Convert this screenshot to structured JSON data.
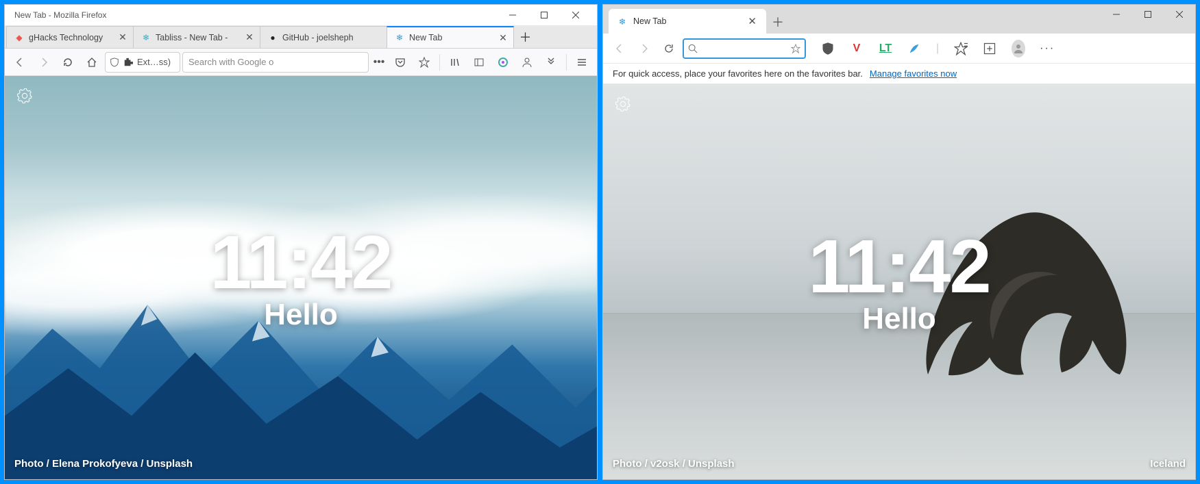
{
  "firefox": {
    "window_title": "New Tab - Mozilla Firefox",
    "tabs": [
      {
        "label": "gHacks Technology"
      },
      {
        "label": "Tabliss - New Tab -"
      },
      {
        "label": "GitHub - joelsheph"
      },
      {
        "label": "New Tab"
      }
    ],
    "urlbar_text": "Ext…ss)",
    "searchbar_placeholder": "Search with Google o",
    "content": {
      "time": "11:42",
      "greeting": "Hello",
      "credit": "Photo / Elena Prokofyeva / Unsplash"
    }
  },
  "edge": {
    "tab_label": "New Tab",
    "favbar_text": "For quick access, place your favorites here on the favorites bar.",
    "favbar_link": "Manage favorites now",
    "content": {
      "time": "11:42",
      "greeting": "Hello",
      "credit": "Photo / v2osk / Unsplash",
      "location": "Iceland"
    }
  }
}
